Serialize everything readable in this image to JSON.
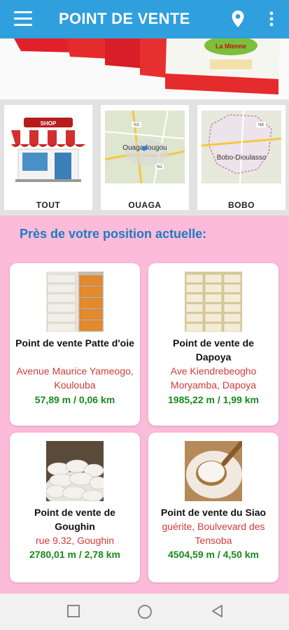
{
  "appbar": {
    "title": "POINT DE VENTE",
    "menu_icon": "menu-icon",
    "pin_icon": "location-pin-icon",
    "more_icon": "more-vert-icon"
  },
  "banner": {
    "brand_text": "La Mienne"
  },
  "categories": [
    {
      "label": "TOUT",
      "sign": "SHOP"
    },
    {
      "label": "OUAGA",
      "map_label": "Ouagadougou",
      "road1": "N3",
      "road2": "N2"
    },
    {
      "label": "BOBO",
      "map_label": "Bobo-Dioulasso",
      "road1": "N8"
    }
  ],
  "nearby": {
    "heading": "Près de votre position actuelle:",
    "points": [
      {
        "name": "Point de vente Patte d'oie",
        "address": "Avenue Maurice Yameogo, Koulouba",
        "distance": "57,89 m / 0,06 km"
      },
      {
        "name": "Point de vente de Dapoya",
        "address": "Ave Kiendrebeogho Moryamba, Dapoya",
        "distance": "1985,22 m / 1,99 km"
      },
      {
        "name": "Point de vente de Goughin",
        "address": "rue 9.32, Goughin",
        "distance": "2780,01 m / 2,78 km"
      },
      {
        "name": "Point de vente du Siao",
        "address": "guérite, Boulvevard des Tensoba",
        "distance": "4504,59 m / 4,50 km"
      }
    ]
  },
  "colors": {
    "appbar": "#2f9fdd",
    "pink_bg": "#fbbbd9",
    "heading": "#1f7bc1",
    "address": "#d23a3a",
    "distance": "#1a8a1a"
  }
}
